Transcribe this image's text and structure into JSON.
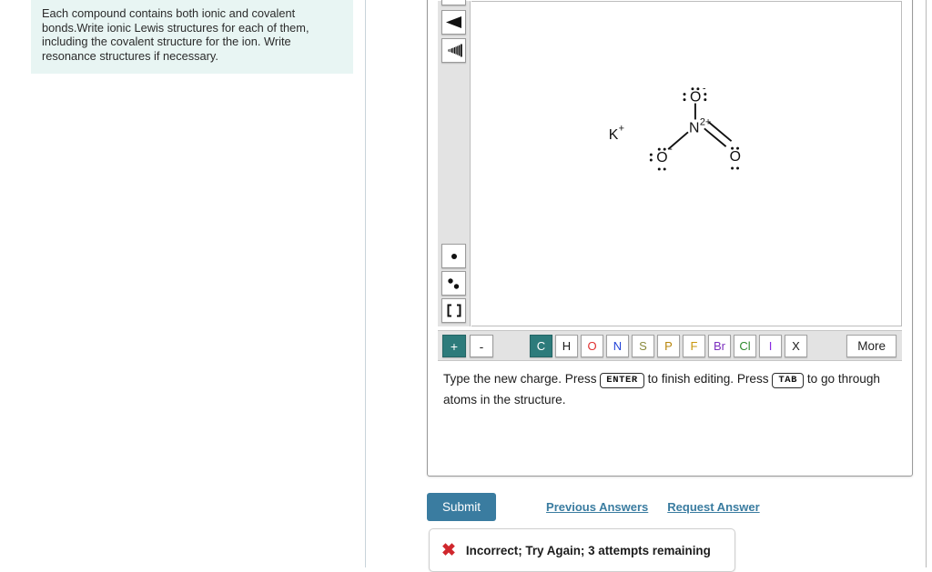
{
  "hint": {
    "text": "Each compound contains both ionic and covalent bonds.Write ionic Lewis structures for each of them, including the covalent structure for the ion. Write resonance structures if necessary."
  },
  "editor": {
    "tools": [
      {
        "name": "wedge-bond-tool",
        "icon": "wedge-bond"
      },
      {
        "name": "hash-bond-tool",
        "icon": "hash-bond"
      },
      {
        "name": "single-electron-tool",
        "icon": "single-electron"
      },
      {
        "name": "lone-pair-tool",
        "icon": "lone-pair"
      },
      {
        "name": "brackets-tool",
        "icon": "brackets"
      }
    ],
    "charge_buttons": [
      {
        "label": "+",
        "active": true
      },
      {
        "label": "-",
        "active": false
      }
    ],
    "elements": [
      {
        "label": "C",
        "color": "#ffffff",
        "active": true
      },
      {
        "label": "H",
        "color": "#1a1a1a",
        "active": false
      },
      {
        "label": "O",
        "color": "#e03131",
        "active": false
      },
      {
        "label": "N",
        "color": "#2344d8",
        "active": false
      },
      {
        "label": "S",
        "color": "#8a8a3c",
        "active": false
      },
      {
        "label": "P",
        "color": "#b8860b",
        "active": false
      },
      {
        "label": "F",
        "color": "#c8960c",
        "active": false
      },
      {
        "label": "Br",
        "color": "#7b2fbe",
        "active": false
      },
      {
        "label": "Cl",
        "color": "#2e8b2e",
        "active": false
      },
      {
        "label": "I",
        "color": "#8a2be2",
        "active": false
      },
      {
        "label": "X",
        "color": "#1a1a1a",
        "active": false
      }
    ],
    "more_label": "More",
    "instruction": {
      "part1": "Type the new charge. Press",
      "key1": "ENTER",
      "part2": "to finish editing. Press",
      "key2": "TAB",
      "part3": "to go through atoms in the structure."
    }
  },
  "molecule": {
    "cation_label": "K",
    "cation_charge": "+",
    "center_atom": "N",
    "center_charge": "2+",
    "oxygen_top": "O",
    "oxygen_top_charge": "-",
    "oxygen_left": "O",
    "oxygen_left_charge": "-",
    "oxygen_right": "O"
  },
  "actions": {
    "submit_label": "Submit",
    "previous_answers_label": "Previous Answers",
    "request_answer_label": "Request Answer"
  },
  "feedback": {
    "icon": "x-mark-icon",
    "message": "Incorrect; Try Again; 3 attempts remaining",
    "color": "#d0272d"
  }
}
